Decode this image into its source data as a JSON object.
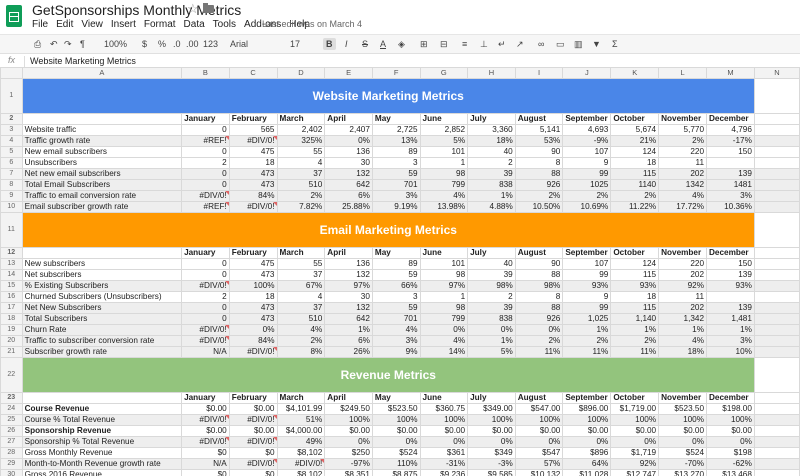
{
  "app": {
    "title": "GetSponsorships Monthly Metrics",
    "menu": [
      "File",
      "Edit",
      "View",
      "Insert",
      "Format",
      "Data",
      "Tools",
      "Add-ons",
      "Help"
    ],
    "last_edit": "Last edit was on March 4"
  },
  "toolbar": {
    "zoom": "100%",
    "currency": "$",
    "percent": "%",
    "decimal_less": ".0",
    "decimal_more": ".00",
    "number_format": "123",
    "font": "Arial",
    "font_size": "17",
    "bold": "B",
    "italic": "I",
    "strike": "S",
    "text_color": "A",
    "sum": "Σ"
  },
  "formula_bar": {
    "fx": "fx",
    "value": "Website Marketing Metrics"
  },
  "columns": [
    "A",
    "B",
    "C",
    "D",
    "E",
    "F",
    "G",
    "H",
    "I",
    "J",
    "K",
    "L",
    "M",
    "N"
  ],
  "rows": [
    {
      "n": "1",
      "type": "banner",
      "color": "blue",
      "title": "Website Marketing Metrics"
    },
    {
      "n": "2",
      "type": "months",
      "cells": [
        "",
        "January",
        "February",
        "March",
        "April",
        "May",
        "June",
        "July",
        "August",
        "September",
        "October",
        "November",
        "December",
        ""
      ]
    },
    {
      "n": "3",
      "cells": [
        "Website traffic",
        "0",
        "565",
        "2,402",
        "2,407",
        "2,725",
        "2,852",
        "3,360",
        "5,141",
        "4,693",
        "5,674",
        "5,770",
        "4,796",
        ""
      ]
    },
    {
      "n": "4",
      "shade": true,
      "cells": [
        "Traffic growth rate",
        "#REF!",
        "#DIV/0!",
        "325%",
        "0%",
        "13%",
        "5%",
        "18%",
        "53%",
        "-9%",
        "21%",
        "2%",
        "-17%",
        ""
      ]
    },
    {
      "n": "5",
      "cells": [
        "New email subscribers",
        "0",
        "475",
        "55",
        "136",
        "89",
        "101",
        "40",
        "90",
        "107",
        "124",
        "220",
        "150",
        ""
      ]
    },
    {
      "n": "6",
      "cells": [
        "Unsubscribers",
        "2",
        "18",
        "4",
        "30",
        "3",
        "1",
        "2",
        "8",
        "9",
        "18",
        "11",
        "",
        ""
      ]
    },
    {
      "n": "7",
      "shade": true,
      "cells": [
        "Net new email subscribers",
        "0",
        "473",
        "37",
        "132",
        "59",
        "98",
        "39",
        "88",
        "99",
        "115",
        "202",
        "139",
        ""
      ]
    },
    {
      "n": "8",
      "shade": true,
      "cells": [
        "Total Email Subscribers",
        "0",
        "473",
        "510",
        "642",
        "701",
        "799",
        "838",
        "926",
        "1025",
        "1140",
        "1342",
        "1481",
        ""
      ]
    },
    {
      "n": "9",
      "shade": true,
      "cells": [
        "Traffic to email conversion rate",
        "#DIV/0!",
        "84%",
        "2%",
        "6%",
        "3%",
        "4%",
        "1%",
        "2%",
        "2%",
        "2%",
        "4%",
        "3%",
        ""
      ]
    },
    {
      "n": "10",
      "shade": true,
      "cells": [
        "Email subscriber growth rate",
        "#REF!",
        "#DIV/0!",
        "7.82%",
        "25.88%",
        "9.19%",
        "13.98%",
        "4.88%",
        "10.50%",
        "10.69%",
        "11.22%",
        "17.72%",
        "10.36%",
        ""
      ]
    },
    {
      "n": "11",
      "type": "banner",
      "color": "orange",
      "title": "Email Marketing Metrics"
    },
    {
      "n": "12",
      "type": "months",
      "cells": [
        "",
        "January",
        "February",
        "March",
        "April",
        "May",
        "June",
        "July",
        "August",
        "September",
        "October",
        "November",
        "December",
        ""
      ]
    },
    {
      "n": "13",
      "cells": [
        "New subscribers",
        "0",
        "475",
        "55",
        "136",
        "89",
        "101",
        "40",
        "90",
        "107",
        "124",
        "220",
        "150",
        ""
      ]
    },
    {
      "n": "14",
      "cells": [
        "Net subscribers",
        "0",
        "473",
        "37",
        "132",
        "59",
        "98",
        "39",
        "88",
        "99",
        "115",
        "202",
        "139",
        ""
      ]
    },
    {
      "n": "15",
      "shade": true,
      "cells": [
        "% Existing Subscribers",
        "#DIV/0!",
        "100%",
        "67%",
        "97%",
        "66%",
        "97%",
        "98%",
        "98%",
        "93%",
        "93%",
        "92%",
        "93%",
        ""
      ]
    },
    {
      "n": "16",
      "cells": [
        "Churned Subscribers (Unsubscribers)",
        "2",
        "18",
        "4",
        "30",
        "3",
        "1",
        "2",
        "8",
        "9",
        "18",
        "11",
        "",
        ""
      ]
    },
    {
      "n": "17",
      "shade": true,
      "cells": [
        "Net New Subscribers",
        "0",
        "473",
        "37",
        "132",
        "59",
        "98",
        "39",
        "88",
        "99",
        "115",
        "202",
        "139",
        ""
      ]
    },
    {
      "n": "18",
      "shade": true,
      "cells": [
        "Total Subscribers",
        "0",
        "473",
        "510",
        "642",
        "701",
        "799",
        "838",
        "926",
        "1,025",
        "1,140",
        "1,342",
        "1,481",
        ""
      ]
    },
    {
      "n": "19",
      "shade": true,
      "cells": [
        "Churn Rate",
        "#DIV/0!",
        "0%",
        "4%",
        "1%",
        "4%",
        "0%",
        "0%",
        "0%",
        "1%",
        "1%",
        "1%",
        "1%",
        ""
      ]
    },
    {
      "n": "20",
      "shade": true,
      "cells": [
        "Traffic to subscriber conversion rate",
        "#DIV/0!",
        "84%",
        "2%",
        "6%",
        "3%",
        "4%",
        "1%",
        "2%",
        "2%",
        "2%",
        "4%",
        "3%",
        ""
      ]
    },
    {
      "n": "21",
      "shade": true,
      "cells": [
        "Subscriber growth rate",
        "N/A",
        "#DIV/0!",
        "8%",
        "26%",
        "9%",
        "14%",
        "5%",
        "11%",
        "11%",
        "11%",
        "18%",
        "10%",
        ""
      ]
    },
    {
      "n": "22",
      "type": "banner",
      "color": "green",
      "title": "Revenue Metrics"
    },
    {
      "n": "23",
      "type": "months",
      "cells": [
        "",
        "January",
        "February",
        "March",
        "April",
        "May",
        "June",
        "July",
        "August",
        "September",
        "October",
        "November",
        "December",
        ""
      ]
    },
    {
      "n": "24",
      "bold_label": true,
      "cells": [
        "Course Revenue",
        "$0.00",
        "$0.00",
        "$4,101.99",
        "$249.50",
        "$523.50",
        "$360.75",
        "$349.00",
        "$547.00",
        "$896.00",
        "$1,719.00",
        "$523.50",
        "$198.00",
        ""
      ]
    },
    {
      "n": "25",
      "shade": true,
      "cells": [
        "Course % Total Revenue",
        "#DIV/0!",
        "#DIV/0!",
        "51%",
        "100%",
        "100%",
        "100%",
        "100%",
        "100%",
        "100%",
        "100%",
        "100%",
        "100%",
        ""
      ]
    },
    {
      "n": "26",
      "bold_label": true,
      "cells": [
        "Sponsorship Revenue",
        "$0.00",
        "$0.00",
        "$4,000.00",
        "$0.00",
        "$0.00",
        "$0.00",
        "$0.00",
        "$0.00",
        "$0.00",
        "$0.00",
        "$0.00",
        "$0.00",
        ""
      ]
    },
    {
      "n": "27",
      "shade": true,
      "cells": [
        "Sponsorship % Total Revenue",
        "#DIV/0!",
        "#DIV/0!",
        "49%",
        "0%",
        "0%",
        "0%",
        "0%",
        "0%",
        "0%",
        "0%",
        "0%",
        "0%",
        ""
      ]
    },
    {
      "n": "28",
      "cells": [
        "Gross Monthly Revenue",
        "$0",
        "$0",
        "$8,102",
        "$250",
        "$524",
        "$361",
        "$349",
        "$547",
        "$896",
        "$1,719",
        "$524",
        "$198",
        ""
      ]
    },
    {
      "n": "29",
      "shade": true,
      "cells": [
        "Month-to-Month Revenue growth rate",
        "N/A",
        "#DIV/0!",
        "#DIV/0!",
        "-97%",
        "110%",
        "-31%",
        "-3%",
        "57%",
        "64%",
        "92%",
        "-70%",
        "-62%",
        ""
      ]
    },
    {
      "n": "30",
      "cells": [
        "Gross 2016 Revenue",
        "$0",
        "$0",
        "$8,102",
        "$8,351",
        "$8,875",
        "$9,236",
        "$9,585",
        "$10,132",
        "$11,028",
        "$12,747",
        "$13,270",
        "$13,468",
        ""
      ]
    }
  ]
}
